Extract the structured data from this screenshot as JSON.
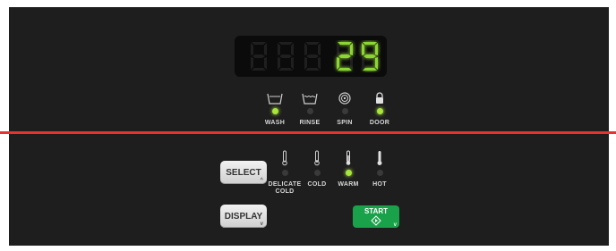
{
  "display": {
    "digits": [
      "",
      "",
      "",
      "2",
      "9"
    ]
  },
  "status_indicators": [
    {
      "label": "WASH",
      "icon": "wash-tub-icon",
      "led_on": true
    },
    {
      "label": "RINSE",
      "icon": "rinse-tub-icon",
      "led_on": false
    },
    {
      "label": "SPIN",
      "icon": "spin-icon",
      "led_on": false
    },
    {
      "label": "DOOR",
      "icon": "lock-icon",
      "led_on": true
    }
  ],
  "temperature_options": [
    {
      "label": "DELICATE\nCOLD",
      "icon": "thermometer-icon",
      "led_on": false
    },
    {
      "label": "COLD",
      "icon": "thermometer-icon",
      "led_on": false
    },
    {
      "label": "WARM",
      "icon": "thermometer-icon",
      "led_on": true
    },
    {
      "label": "HOT",
      "icon": "thermometer-icon",
      "led_on": false
    }
  ],
  "buttons": {
    "select": "SELECT",
    "display": "DISPLAY",
    "start": "START"
  },
  "colors": {
    "panel": "#1e1e1e",
    "divider": "#e8322f",
    "led_on": "#a8e63a",
    "segment_on": "#8ad633",
    "start_button": "#1aa24a"
  }
}
